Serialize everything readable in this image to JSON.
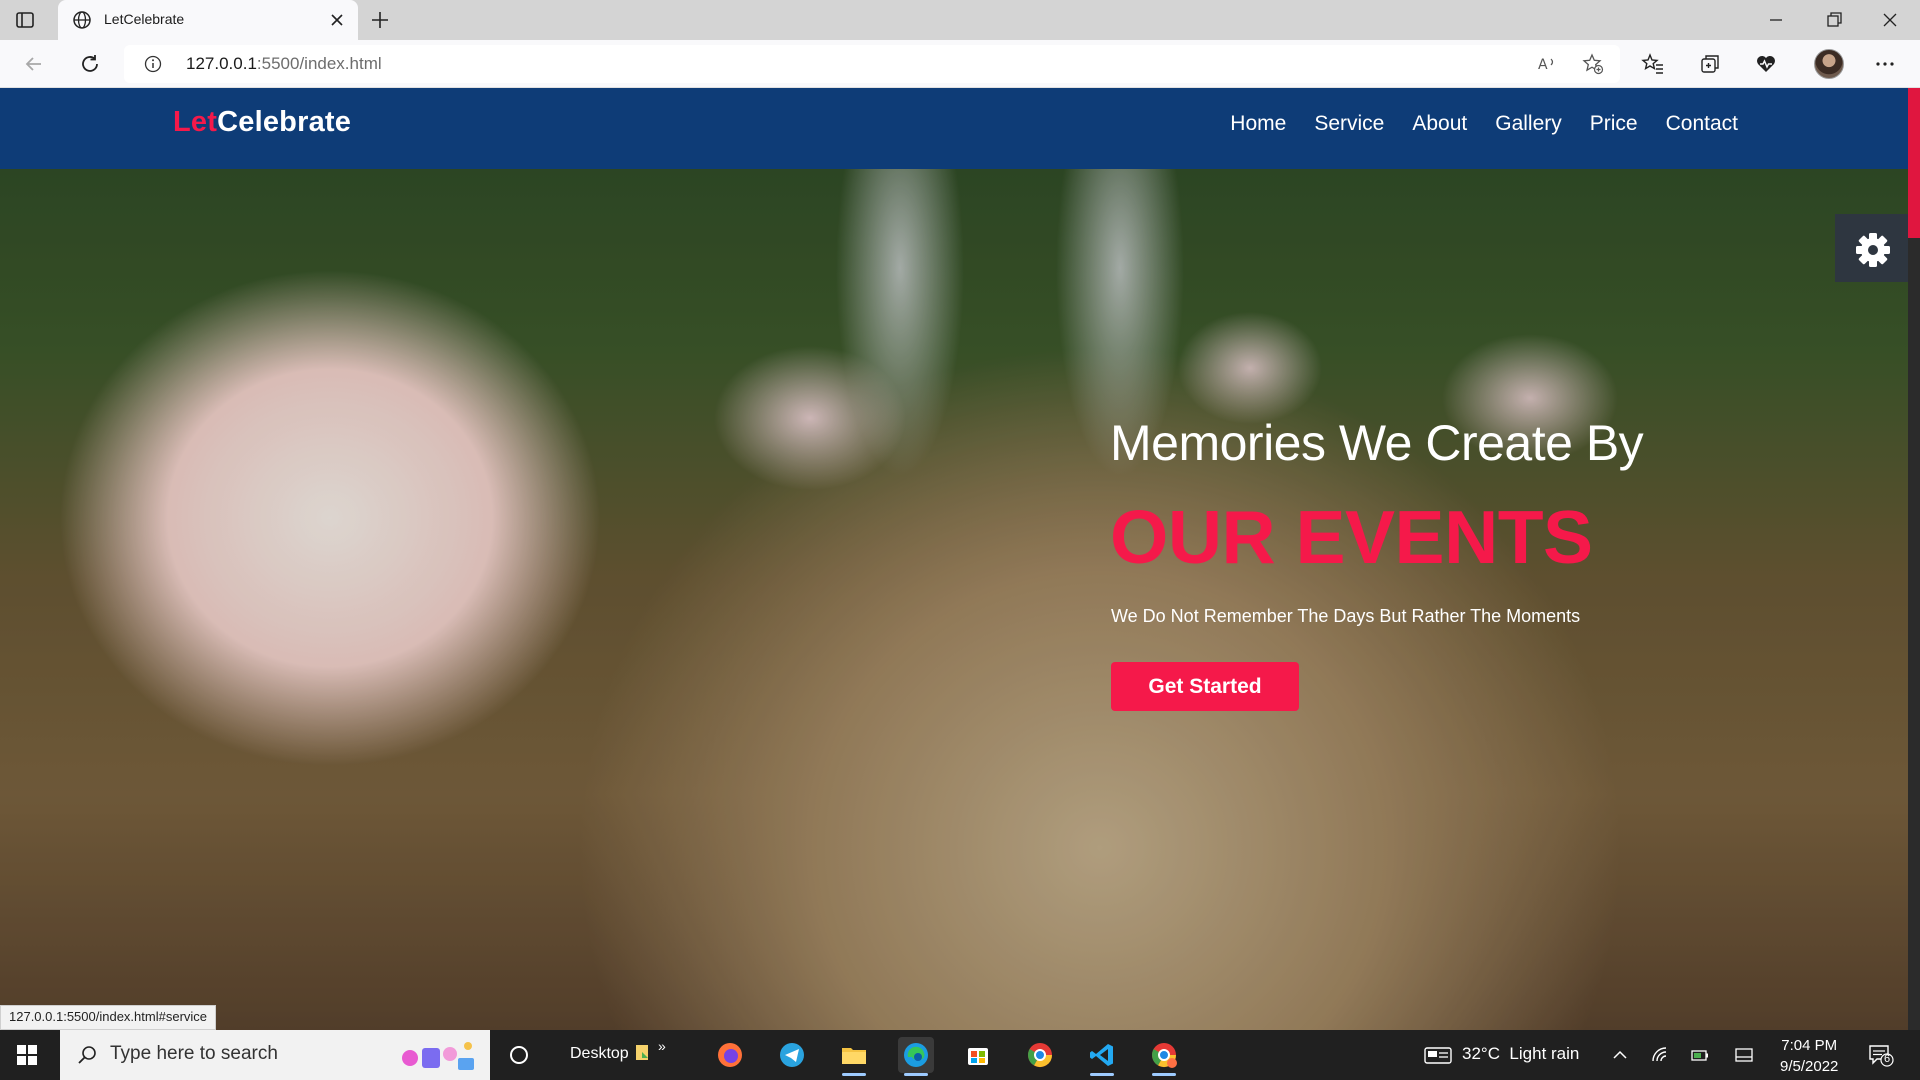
{
  "browser": {
    "tab_title": "LetCelebrate",
    "url_host": "127.0.0.1",
    "url_rest": ":5500/index.html",
    "status_url": "127.0.0.1:5500/index.html#service"
  },
  "site": {
    "logo_part1": "Let",
    "logo_part2": "Celebrate",
    "nav": [
      {
        "label": "Home"
      },
      {
        "label": "Service"
      },
      {
        "label": "About"
      },
      {
        "label": "Gallery"
      },
      {
        "label": "Price"
      },
      {
        "label": "Contact"
      }
    ],
    "hero": {
      "subtitle": "Memories We Create By",
      "title": "OUR EVENTS",
      "tagline": "We Do Not Remember The Days But Rather The Moments",
      "cta_label": "Get Started"
    },
    "colors": {
      "accent": "#f5194a",
      "navbar": "#0e3c77"
    }
  },
  "taskbar": {
    "search_placeholder": "Type here to search",
    "desktop_label": "Desktop",
    "weather": "32°C  Light rain",
    "time": "7:04 PM",
    "date": "9/5/2022",
    "notification_count": "6"
  }
}
